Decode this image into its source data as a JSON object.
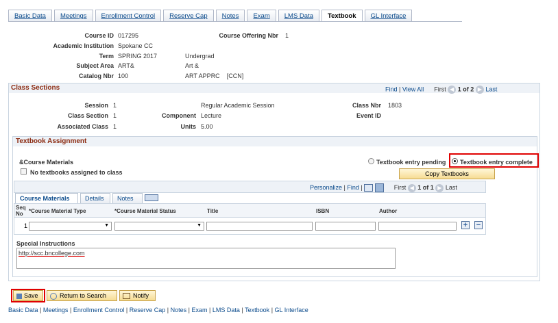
{
  "tabs": [
    "Basic Data",
    "Meetings",
    "Enrollment Control",
    "Reserve Cap",
    "Notes",
    "Exam",
    "LMS Data",
    "Textbook",
    "GL Interface"
  ],
  "active_tab": "Textbook",
  "course": {
    "course_id_label": "Course ID",
    "course_id": "017295",
    "offering_label": "Course Offering Nbr",
    "offering": "1",
    "institution_label": "Academic Institution",
    "institution": "Spokane CC",
    "term_label": "Term",
    "term": "SPRING 2017",
    "career": "Undergrad",
    "subject_label": "Subject Area",
    "subject": "ART&",
    "subject_desc": "Art &",
    "catalog_label": "Catalog Nbr",
    "catalog": "100",
    "catalog_desc": "ART APPRC    [CCN]"
  },
  "class_sections": {
    "title": "Class Sections",
    "find": "Find",
    "view_all": "View All",
    "first": "First",
    "range": "1 of 2",
    "last": "Last",
    "session_label": "Session",
    "session": "1",
    "session_desc": "Regular Academic Session",
    "class_nbr_label": "Class Nbr",
    "class_nbr": "1803",
    "class_section_label": "Class Section",
    "class_section": "1",
    "component_label": "Component",
    "component": "Lecture",
    "event_id_label": "Event ID",
    "assoc_label": "Associated Class",
    "assoc": "1",
    "units_label": "Units",
    "units": "5.00"
  },
  "textbook": {
    "title": "Textbook Assignment",
    "course_materials_label": "&Course Materials",
    "no_textbooks": "No textbooks assigned to class",
    "radio_pending": "Textbook entry pending",
    "radio_complete": "Textbook entry complete",
    "copy_button": "Copy Textbooks",
    "grid_nav": {
      "personalize": "Personalize",
      "find": "Find",
      "first": "First",
      "range": "1 of 1",
      "last": "Last"
    },
    "subtabs": [
      "Course Materials",
      "Details",
      "Notes"
    ],
    "columns": {
      "seq": "Seq No",
      "type": "*Course Material Type",
      "status": "*Course Material Status",
      "title": "Title",
      "isbn": "ISBN",
      "author": "Author"
    },
    "row_seq": "1",
    "special_label": "Special Instructions",
    "special_value": "http://scc.bncollege.com"
  },
  "buttons": {
    "save": "Save",
    "return": "Return to Search",
    "notify": "Notify"
  },
  "footer_links": [
    "Basic Data",
    "Meetings",
    "Enrollment Control",
    "Reserve Cap",
    "Notes",
    "Exam",
    "LMS Data",
    "Textbook",
    "GL Interface"
  ]
}
